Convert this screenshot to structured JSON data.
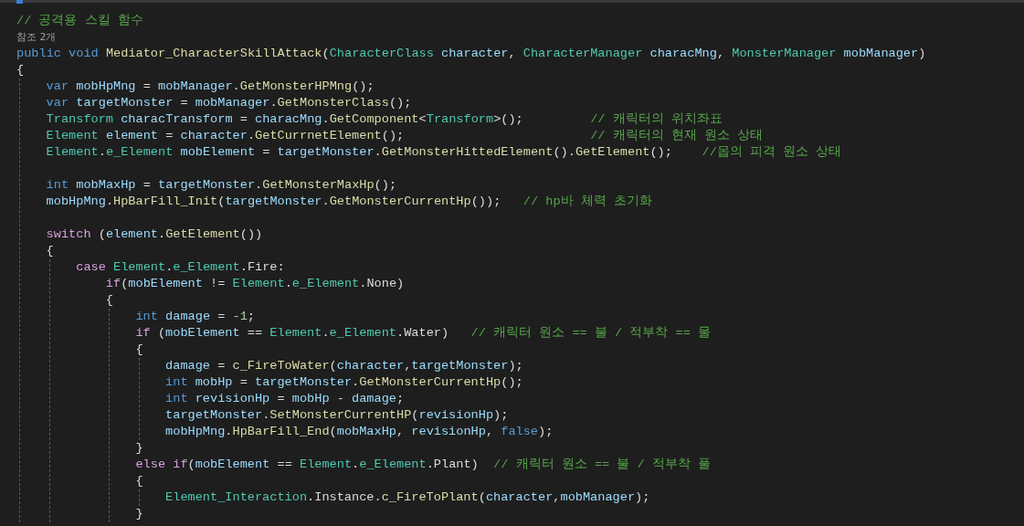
{
  "editor": {
    "lines": [
      {
        "kind": "line",
        "tokens": [
          {
            "kind": "comment",
            "text": "// 공격용 스킬 함수"
          }
        ]
      },
      {
        "kind": "codelens",
        "text": "참조 2개"
      },
      {
        "kind": "line",
        "tokens": [
          {
            "kind": "keyword",
            "text": "public"
          },
          {
            "kind": "keyword",
            "text": " void"
          },
          {
            "kind": "method",
            "text": " Mediator_CharacterSkillAttack"
          },
          {
            "kind": "plain",
            "text": "("
          },
          {
            "kind": "type",
            "text": "CharacterClass"
          },
          {
            "kind": "variable",
            "text": " character"
          },
          {
            "kind": "plain",
            "text": ","
          },
          {
            "kind": "type",
            "text": " CharacterManager"
          },
          {
            "kind": "variable",
            "text": " characMng"
          },
          {
            "kind": "plain",
            "text": ","
          },
          {
            "kind": "type",
            "text": " MonsterManager"
          },
          {
            "kind": "variable",
            "text": " mobManager"
          },
          {
            "kind": "plain",
            "text": ")"
          }
        ]
      },
      {
        "kind": "block",
        "open": "{",
        "children": [
          {
            "kind": "line",
            "tokens": [
              {
                "kind": "keyword",
                "text": "var"
              },
              {
                "kind": "variable",
                "text": " mobHpMng"
              },
              {
                "kind": "plain",
                "text": " = "
              },
              {
                "kind": "variable",
                "text": "mobManager"
              },
              {
                "kind": "plain",
                "text": "."
              },
              {
                "kind": "method",
                "text": "GetMonsterHPMng"
              },
              {
                "kind": "plain",
                "text": "();"
              }
            ]
          },
          {
            "kind": "line",
            "tokens": [
              {
                "kind": "keyword",
                "text": "var"
              },
              {
                "kind": "variable",
                "text": " targetMonster"
              },
              {
                "kind": "plain",
                "text": " = "
              },
              {
                "kind": "variable",
                "text": "mobManager"
              },
              {
                "kind": "plain",
                "text": "."
              },
              {
                "kind": "method",
                "text": "GetMonsterClass"
              },
              {
                "kind": "plain",
                "text": "();"
              }
            ]
          },
          {
            "kind": "line",
            "tokens": [
              {
                "kind": "type",
                "text": "Transform"
              },
              {
                "kind": "variable",
                "text": " characTransform"
              },
              {
                "kind": "plain",
                "text": " = "
              },
              {
                "kind": "variable",
                "text": "characMng"
              },
              {
                "kind": "plain",
                "text": "."
              },
              {
                "kind": "method",
                "text": "GetComponent"
              },
              {
                "kind": "plain",
                "text": "<"
              },
              {
                "kind": "type",
                "text": "Transform"
              },
              {
                "kind": "plain",
                "text": ">();"
              },
              {
                "kind": "comment",
                "text": "         // 캐릭터의 위치좌표"
              }
            ]
          },
          {
            "kind": "line",
            "tokens": [
              {
                "kind": "type",
                "text": "Element"
              },
              {
                "kind": "variable",
                "text": " element"
              },
              {
                "kind": "plain",
                "text": " = "
              },
              {
                "kind": "variable",
                "text": "character"
              },
              {
                "kind": "plain",
                "text": "."
              },
              {
                "kind": "method",
                "text": "GetCurrnetElement"
              },
              {
                "kind": "plain",
                "text": "();"
              },
              {
                "kind": "comment",
                "text": "                         // 캐릭터의 현재 원소 상태"
              }
            ]
          },
          {
            "kind": "line",
            "tokens": [
              {
                "kind": "type",
                "text": "Element"
              },
              {
                "kind": "plain",
                "text": "."
              },
              {
                "kind": "type",
                "text": "e_Element"
              },
              {
                "kind": "variable",
                "text": " mobElement"
              },
              {
                "kind": "plain",
                "text": " = "
              },
              {
                "kind": "variable",
                "text": "targetMonster"
              },
              {
                "kind": "plain",
                "text": "."
              },
              {
                "kind": "method",
                "text": "GetMonsterHittedElement"
              },
              {
                "kind": "plain",
                "text": "()."
              },
              {
                "kind": "method",
                "text": "GetElement"
              },
              {
                "kind": "plain",
                "text": "();"
              },
              {
                "kind": "comment",
                "text": "    //몹의 피격 원소 상태"
              }
            ]
          },
          {
            "kind": "blank"
          },
          {
            "kind": "line",
            "tokens": [
              {
                "kind": "keyword",
                "text": "int"
              },
              {
                "kind": "variable",
                "text": " mobMaxHp"
              },
              {
                "kind": "plain",
                "text": " = "
              },
              {
                "kind": "variable",
                "text": "targetMonster"
              },
              {
                "kind": "plain",
                "text": "."
              },
              {
                "kind": "method",
                "text": "GetMonsterMaxHp"
              },
              {
                "kind": "plain",
                "text": "();"
              }
            ]
          },
          {
            "kind": "line",
            "tokens": [
              {
                "kind": "variable",
                "text": "mobHpMng"
              },
              {
                "kind": "plain",
                "text": "."
              },
              {
                "kind": "method",
                "text": "HpBarFill_Init"
              },
              {
                "kind": "plain",
                "text": "("
              },
              {
                "kind": "variable",
                "text": "targetMonster"
              },
              {
                "kind": "plain",
                "text": "."
              },
              {
                "kind": "method",
                "text": "GetMonsterCurrentHp"
              },
              {
                "kind": "plain",
                "text": "());"
              },
              {
                "kind": "comment",
                "text": "   // hp바 체력 초기화"
              }
            ]
          },
          {
            "kind": "blank"
          },
          {
            "kind": "line",
            "tokens": [
              {
                "kind": "control",
                "text": "switch"
              },
              {
                "kind": "plain",
                "text": " ("
              },
              {
                "kind": "variable",
                "text": "element"
              },
              {
                "kind": "plain",
                "text": "."
              },
              {
                "kind": "method",
                "text": "GetElement"
              },
              {
                "kind": "plain",
                "text": "())"
              }
            ]
          },
          {
            "kind": "block",
            "open": "{",
            "children": [
              {
                "kind": "line",
                "tokens": [
                  {
                    "kind": "control",
                    "text": "case"
                  },
                  {
                    "kind": "type",
                    "text": " Element"
                  },
                  {
                    "kind": "plain",
                    "text": "."
                  },
                  {
                    "kind": "type",
                    "text": "e_Element"
                  },
                  {
                    "kind": "plain",
                    "text": ".Fire:"
                  }
                ],
                "children": [
                  {
                    "kind": "line",
                    "tokens": [
                      {
                        "kind": "control",
                        "text": "if"
                      },
                      {
                        "kind": "plain",
                        "text": "("
                      },
                      {
                        "kind": "variable",
                        "text": "mobElement"
                      },
                      {
                        "kind": "plain",
                        "text": " != "
                      },
                      {
                        "kind": "type",
                        "text": "Element"
                      },
                      {
                        "kind": "plain",
                        "text": "."
                      },
                      {
                        "kind": "type",
                        "text": "e_Element"
                      },
                      {
                        "kind": "plain",
                        "text": ".None)"
                      }
                    ]
                  },
                  {
                    "kind": "block",
                    "open": "{",
                    "children": [
                      {
                        "kind": "line",
                        "tokens": [
                          {
                            "kind": "keyword",
                            "text": "int"
                          },
                          {
                            "kind": "variable",
                            "text": " damage"
                          },
                          {
                            "kind": "plain",
                            "text": " = "
                          },
                          {
                            "kind": "number",
                            "text": "-1"
                          },
                          {
                            "kind": "plain",
                            "text": ";"
                          }
                        ]
                      },
                      {
                        "kind": "line",
                        "tokens": [
                          {
                            "kind": "control",
                            "text": "if"
                          },
                          {
                            "kind": "plain",
                            "text": " ("
                          },
                          {
                            "kind": "variable",
                            "text": "mobElement"
                          },
                          {
                            "kind": "plain",
                            "text": " == "
                          },
                          {
                            "kind": "type",
                            "text": "Element"
                          },
                          {
                            "kind": "plain",
                            "text": "."
                          },
                          {
                            "kind": "type",
                            "text": "e_Element"
                          },
                          {
                            "kind": "plain",
                            "text": ".Water)"
                          },
                          {
                            "kind": "comment",
                            "text": "   // 캐릭터 원소 == 불 / 적부착 == 물"
                          }
                        ]
                      },
                      {
                        "kind": "block",
                        "open": "{",
                        "close": "}",
                        "children": [
                          {
                            "kind": "line",
                            "tokens": [
                              {
                                "kind": "variable",
                                "text": "damage"
                              },
                              {
                                "kind": "plain",
                                "text": " = "
                              },
                              {
                                "kind": "method",
                                "text": "c_FireToWater"
                              },
                              {
                                "kind": "plain",
                                "text": "("
                              },
                              {
                                "kind": "variable",
                                "text": "character"
                              },
                              {
                                "kind": "plain",
                                "text": ","
                              },
                              {
                                "kind": "variable",
                                "text": "targetMonster"
                              },
                              {
                                "kind": "plain",
                                "text": ");"
                              }
                            ]
                          },
                          {
                            "kind": "line",
                            "tokens": [
                              {
                                "kind": "keyword",
                                "text": "int"
                              },
                              {
                                "kind": "variable",
                                "text": " mobHp"
                              },
                              {
                                "kind": "plain",
                                "text": " = "
                              },
                              {
                                "kind": "variable",
                                "text": "targetMonster"
                              },
                              {
                                "kind": "plain",
                                "text": "."
                              },
                              {
                                "kind": "method",
                                "text": "GetMonsterCurrentHp"
                              },
                              {
                                "kind": "plain",
                                "text": "();"
                              }
                            ]
                          },
                          {
                            "kind": "line",
                            "tokens": [
                              {
                                "kind": "keyword",
                                "text": "int"
                              },
                              {
                                "kind": "variable",
                                "text": " revisionHp"
                              },
                              {
                                "kind": "plain",
                                "text": " = "
                              },
                              {
                                "kind": "variable",
                                "text": "mobHp"
                              },
                              {
                                "kind": "plain",
                                "text": " - "
                              },
                              {
                                "kind": "variable",
                                "text": "damage"
                              },
                              {
                                "kind": "plain",
                                "text": ";"
                              }
                            ]
                          },
                          {
                            "kind": "line",
                            "tokens": [
                              {
                                "kind": "variable",
                                "text": "targetMonster"
                              },
                              {
                                "kind": "plain",
                                "text": "."
                              },
                              {
                                "kind": "method",
                                "text": "SetMonsterCurrentHP"
                              },
                              {
                                "kind": "plain",
                                "text": "("
                              },
                              {
                                "kind": "variable",
                                "text": "revisionHp"
                              },
                              {
                                "kind": "plain",
                                "text": ");"
                              }
                            ]
                          },
                          {
                            "kind": "line",
                            "tokens": [
                              {
                                "kind": "variable",
                                "text": "mobHpMng"
                              },
                              {
                                "kind": "plain",
                                "text": "."
                              },
                              {
                                "kind": "method",
                                "text": "HpBarFill_End"
                              },
                              {
                                "kind": "plain",
                                "text": "("
                              },
                              {
                                "kind": "variable",
                                "text": "mobMaxHp"
                              },
                              {
                                "kind": "plain",
                                "text": ","
                              },
                              {
                                "kind": "variable",
                                "text": " revisionHp"
                              },
                              {
                                "kind": "plain",
                                "text": ","
                              },
                              {
                                "kind": "keyword",
                                "text": " false"
                              },
                              {
                                "kind": "plain",
                                "text": ");"
                              }
                            ]
                          }
                        ]
                      },
                      {
                        "kind": "line",
                        "tokens": [
                          {
                            "kind": "control",
                            "text": "else"
                          },
                          {
                            "kind": "control",
                            "text": " if"
                          },
                          {
                            "kind": "plain",
                            "text": "("
                          },
                          {
                            "kind": "variable",
                            "text": "mobElement"
                          },
                          {
                            "kind": "plain",
                            "text": " == "
                          },
                          {
                            "kind": "type",
                            "text": "Element"
                          },
                          {
                            "kind": "plain",
                            "text": "."
                          },
                          {
                            "kind": "type",
                            "text": "e_Element"
                          },
                          {
                            "kind": "plain",
                            "text": ".Plant)"
                          },
                          {
                            "kind": "comment",
                            "text": "  // 캐릭터 원소 == 불 / 적부착 풀"
                          }
                        ]
                      },
                      {
                        "kind": "block",
                        "open": "{",
                        "close": "}",
                        "children": [
                          {
                            "kind": "line",
                            "tokens": [
                              {
                                "kind": "type",
                                "text": "Element_Interaction"
                              },
                              {
                                "kind": "plain",
                                "text": ".Instance."
                              },
                              {
                                "kind": "method",
                                "text": "c_FireToPlant"
                              },
                              {
                                "kind": "plain",
                                "text": "("
                              },
                              {
                                "kind": "variable",
                                "text": "character"
                              },
                              {
                                "kind": "plain",
                                "text": ","
                              },
                              {
                                "kind": "variable",
                                "text": "mobManager"
                              },
                              {
                                "kind": "plain",
                                "text": ");"
                              }
                            ]
                          }
                        ]
                      }
                    ]
                  }
                ]
              }
            ]
          }
        ]
      }
    ]
  }
}
